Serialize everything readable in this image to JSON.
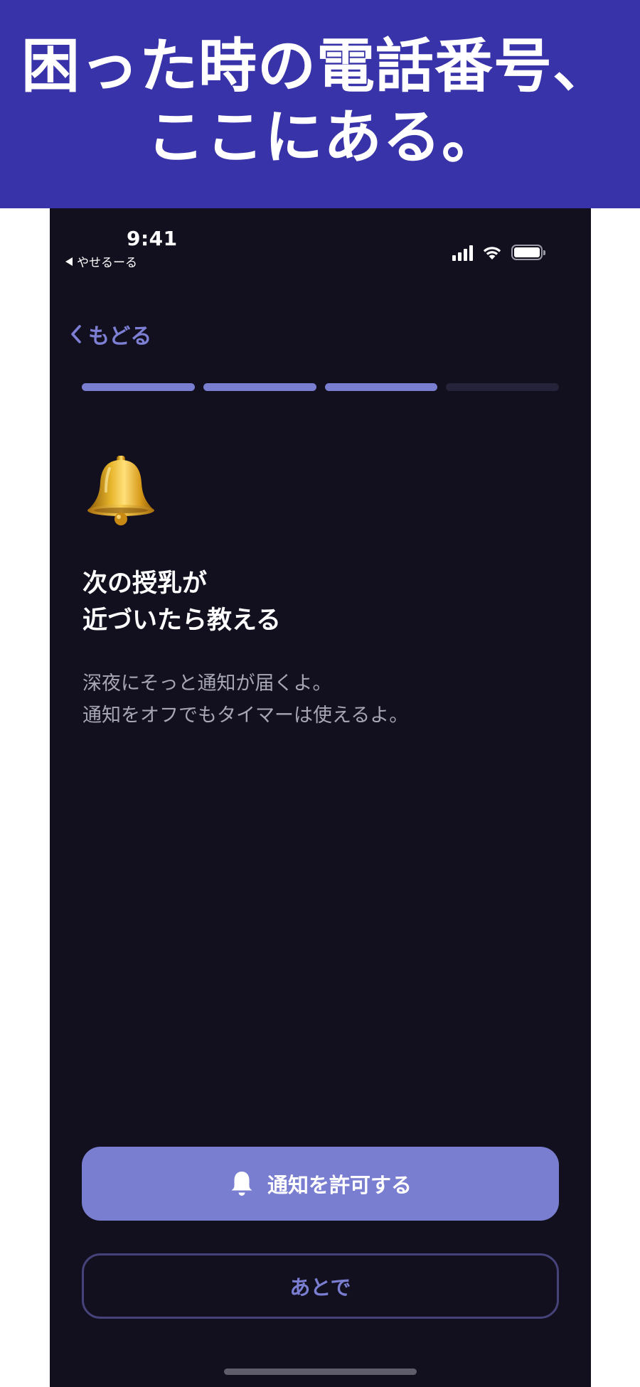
{
  "banner": {
    "line1": "困った時の電話番号、",
    "line2": "ここにある。",
    "bg_color": "#3833a8"
  },
  "status_bar": {
    "time": "9:41",
    "back_app": "やせるーる",
    "icons": [
      "signal-icon",
      "wifi-icon",
      "battery-icon"
    ]
  },
  "nav": {
    "back_label": "もどる"
  },
  "progress": {
    "total_steps": 4,
    "completed_steps": 3
  },
  "content": {
    "emoji": "bell-emoji-icon",
    "title_line1": "次の授乳が",
    "title_line2": "近づいたら教える",
    "desc_line1": "深夜にそっと通知が届くよ。",
    "desc_line2": "通知をオフでもタイマーは使えるよ。"
  },
  "actions": {
    "primary_label": "通知を許可する",
    "secondary_label": "あとで"
  },
  "colors": {
    "screen_bg": "#12101e",
    "accent": "#7a7ed1",
    "progress_off": "#24233a",
    "secondary_border": "#45437a"
  }
}
